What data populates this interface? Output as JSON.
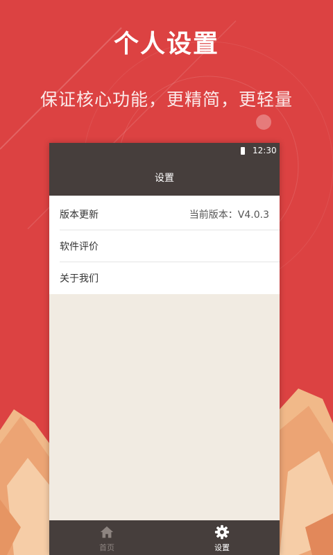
{
  "promo": {
    "title": "个人设置",
    "subtitle": "保证核心功能，更精简，更轻量"
  },
  "status_bar": {
    "time": "12:30",
    "battery_icon": "battery-icon"
  },
  "nav": {
    "title": "设置"
  },
  "settings": {
    "items": [
      {
        "label": "版本更新",
        "value": "当前版本：V4.0.3"
      },
      {
        "label": "软件评价"
      },
      {
        "label": "关于我们"
      }
    ]
  },
  "tabs": [
    {
      "label": "首页",
      "icon": "home-icon",
      "active": false
    },
    {
      "label": "设置",
      "icon": "gear-icon",
      "active": true
    }
  ],
  "colors": {
    "background": "#dc4242",
    "bar": "#463e3c",
    "content_bg": "#f1ebe2",
    "tab_active": "#ffffff",
    "tab_inactive": "#8d8480"
  }
}
